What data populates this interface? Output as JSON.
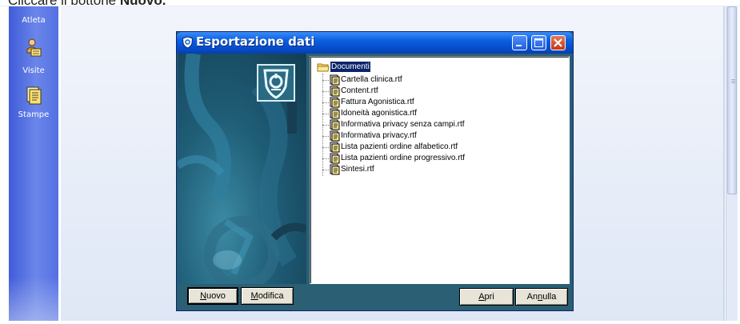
{
  "caption": {
    "text_prefix": "Cliccare il bottone ",
    "text_bold": "Nuovo."
  },
  "nav": {
    "items": [
      {
        "label": "Atleta",
        "icon": "athlete-icon"
      },
      {
        "label": "Visite",
        "icon": "visits-icon"
      },
      {
        "label": "Stampe",
        "icon": "print-icon"
      }
    ]
  },
  "dialog": {
    "title": "Esportazione dati",
    "title_icon": "shield-logo-icon",
    "window_buttons": [
      "minimize-icon",
      "maximize-icon",
      "close-icon"
    ],
    "tree": {
      "root": "Documenti",
      "items": [
        "Cartella clinica.rtf",
        "Content.rtf",
        "Fattura Agonistica.rtf",
        "Idoneità agonistica.rtf",
        "Informativa privacy senza campi.rtf",
        "Informativa privacy.rtf",
        "Lista pazienti ordine alfabetico.rtf",
        "Lista pazienti ordine progressivo.rtf",
        "Sintesi.rtf"
      ]
    },
    "buttons": {
      "new": {
        "label": "Nuovo",
        "accel": "N",
        "rest": "uovo"
      },
      "edit": {
        "label": "Modifica",
        "accel": "M",
        "rest": "odifica"
      },
      "open": {
        "label": "Apri",
        "accel": "A",
        "rest": "pri"
      },
      "cancel": {
        "label": "Annulla",
        "pre": "An",
        "accel": "n",
        "rest": "ulla"
      }
    }
  },
  "colors": {
    "titlebar": "#0a5fe0",
    "dialog_bg": "#2a5f74",
    "nav_bg": "#5470e2",
    "selection": "#0a246a"
  }
}
